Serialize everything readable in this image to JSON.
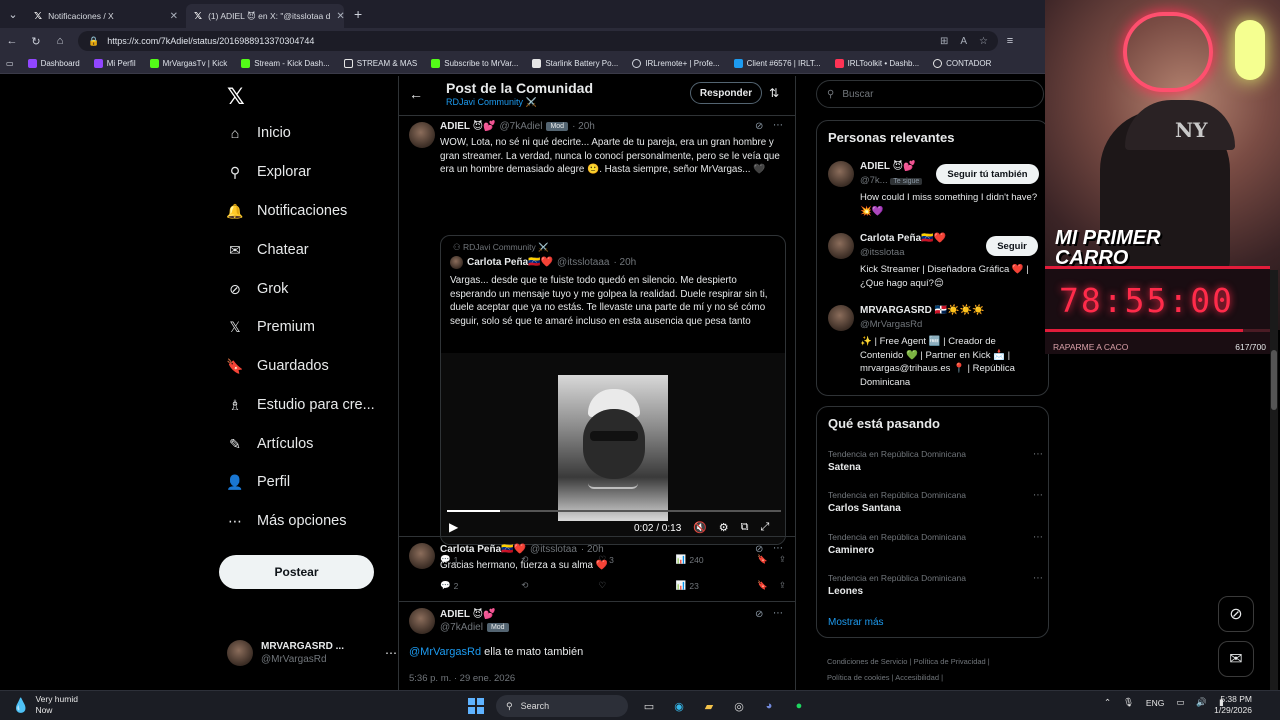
{
  "browser": {
    "tabs": [
      {
        "label": "Notificaciones / X"
      },
      {
        "label": "(1) ADIEL 😈 en X: \"@itsslotaa d"
      }
    ],
    "url": "https://x.com/7kAdiel/status/2016988913370304744",
    "bookmarks": [
      {
        "label": "Dashboard",
        "color": "#9146ff"
      },
      {
        "label": "Mi Perfil",
        "color": "#9146ff"
      },
      {
        "label": "MrVargasTv | Kick",
        "color": "#53fc18"
      },
      {
        "label": "Stream - Kick Dash...",
        "color": "#53fc18"
      },
      {
        "label": "STREAM & MAS",
        "color": "#e6e6e6"
      },
      {
        "label": "Subscribe to MrVar...",
        "color": "#53fc18"
      },
      {
        "label": "Starlink Battery Po...",
        "color": "#e6e6e6"
      },
      {
        "label": "IRLremote+ | Profe...",
        "color": "#cfd3dc"
      },
      {
        "label": "Client #6576 | IRLT...",
        "color": "#1d9bf0"
      },
      {
        "label": "IRLToolkit • Dashb...",
        "color": "#ff3355"
      },
      {
        "label": "CONTADOR",
        "color": "#e6e6e6"
      }
    ]
  },
  "nav": {
    "items": [
      {
        "label": "Inicio",
        "icon": "home-icon",
        "glyph": "⌂"
      },
      {
        "label": "Explorar",
        "icon": "search-icon",
        "glyph": "⚲"
      },
      {
        "label": "Notificaciones",
        "icon": "bell-icon",
        "glyph": "🔔"
      },
      {
        "label": "Chatear",
        "icon": "mail-icon",
        "glyph": "✉"
      },
      {
        "label": "Grok",
        "icon": "grok-icon",
        "glyph": "⊘"
      },
      {
        "label": "Premium",
        "icon": "x-icon",
        "glyph": "𝕏"
      },
      {
        "label": "Guardados",
        "icon": "bookmark-icon",
        "glyph": "🔖"
      },
      {
        "label": "Estudio para cre...",
        "icon": "studio-icon",
        "glyph": "♗"
      },
      {
        "label": "Artículos",
        "icon": "article-icon",
        "glyph": "✎"
      },
      {
        "label": "Perfil",
        "icon": "person-icon",
        "glyph": "👤"
      },
      {
        "label": "Más opciones",
        "icon": "more-icon",
        "glyph": "⋯"
      }
    ],
    "post_button": "Postear",
    "account": {
      "name": "MRVARGASRD ...",
      "handle": "@MrVargasRd"
    }
  },
  "header": {
    "title": "Post de la Comunidad",
    "community": "RDJavi Community ⚔️",
    "reply_button": "Responder"
  },
  "main_post": {
    "name": "ADIEL 😈💕",
    "handle": "@7kAdiel",
    "badge": "Mod",
    "time": "· 20h",
    "text": "WOW, Lota, no sé ni qué decirte... Aparte de tu pareja, era un gran hombre y gran streamer. La verdad, nunca lo conocí personalmente, pero se le veía que era un hombre demasiado alegre 🙂. Hasta siempre, señor MrVargas... 🖤",
    "quote": {
      "community": "RDJavi Community ⚔️",
      "name": "Carlota Peña🇻🇪❤️",
      "handle": "@itsslotaaa",
      "time": "· 20h",
      "text": "Vargas... desde que te fuiste todo quedó en silencio. Me despierto esperando un mensaje tuyo y me golpea la realidad. Duele respirar sin ti, duele aceptar que ya no estás. Te llevaste una parte de mí y no sé cómo seguir, solo sé que te amaré incluso en esta ausencia que pesa tanto",
      "video_time": "0:02 / 0:13",
      "video_progress": 0.16
    },
    "stats": {
      "replies": "1",
      "retweets": "",
      "likes": "3",
      "views": "240"
    }
  },
  "reply1": {
    "name": "Carlota Peña🇻🇪❤️",
    "handle": "@itsslotaa",
    "time": "· 20h",
    "text": "Gracias hermano, fuerza a su alma ❤️",
    "stats": {
      "replies": "2",
      "retweets": "",
      "likes": "",
      "views": "23"
    }
  },
  "reply2": {
    "name": "ADIEL 😈💕",
    "handle": "@7kAdiel",
    "badge": "Mod",
    "mention": "@MrVargasRd",
    "text": " ella te mato también",
    "timestamp": "5:36 p. m. · 29 ene. 2026"
  },
  "right": {
    "search_placeholder": "Buscar",
    "relevant_title": "Personas relevantes",
    "people": [
      {
        "name": "ADIEL 😈💕",
        "handle": "@7k...",
        "tag": "Te sigue",
        "bio": "How could I miss something I didn't have? 💥💜",
        "button": "Seguir tú también"
      },
      {
        "name": "Carlota Peña🇻🇪❤️",
        "handle": "@itsslotaa",
        "bio": "Kick Streamer | Diseñadora Gráfica ❤️ | ¿Que hago aquí?😌",
        "button": "Seguir"
      },
      {
        "name": "MRVARGASRD 🇩🇴☀️☀️☀️",
        "handle": "@MrVargasRd",
        "bio": "✨ | Free Agent 🆓 | Creador de Contenido 💚 | Partner en Kick 📩 | mrvargas@trihaus.es 📍 | República Dominicana"
      }
    ],
    "trending_title": "Qué está pasando",
    "trends": [
      {
        "context": "Tendencia en República Dominicana",
        "name": "Satena"
      },
      {
        "context": "Tendencia en República Dominicana",
        "name": "Carlos Santana"
      },
      {
        "context": "Tendencia en República Dominicana",
        "name": "Caminero"
      },
      {
        "context": "Tendencia en República Dominicana",
        "name": "Leones"
      }
    ],
    "show_more": "Mostrar más",
    "footer": [
      "Condiciones de Servicio",
      "Política de Privacidad",
      "Política de cookies",
      "Accesibilidad"
    ]
  },
  "overlay": {
    "banner_line1": "MI PRIMER",
    "banner_line2": "CARRO",
    "timer": "78:55:00",
    "goal_label": "RAPARME A CACO",
    "goal_count": "617/700",
    "goal_progress": 0.88
  },
  "taskbar": {
    "weather_title": "Very humid",
    "weather_sub": "Now",
    "search": "Search",
    "lang": "ENG",
    "time": "5:38 PM",
    "date": "1/29/2026"
  }
}
